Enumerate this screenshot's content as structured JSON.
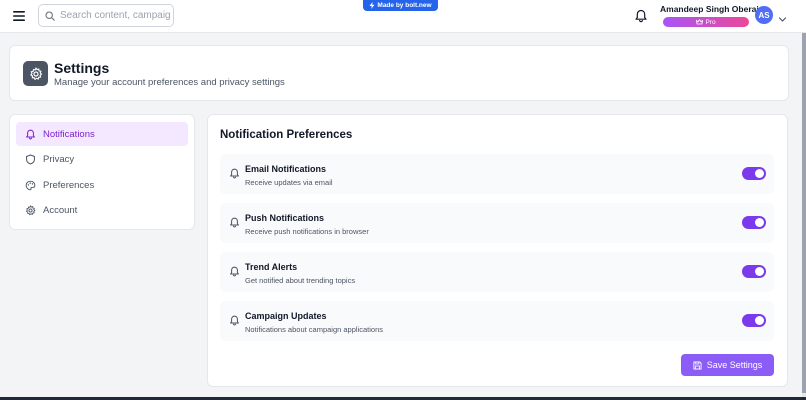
{
  "topbar": {
    "search_placeholder": "Search content, campaign",
    "bolt_badge": "Made by bolt.new",
    "user_name": "Amandeep Singh Oberai",
    "plan_badge": "Pro",
    "avatar_initials": "AS"
  },
  "header": {
    "title": "Settings",
    "subtitle": "Manage your account preferences and privacy settings"
  },
  "sidebar": {
    "items": [
      {
        "label": "Notifications",
        "icon": "bell-icon",
        "active": true
      },
      {
        "label": "Privacy",
        "icon": "shield-icon",
        "active": false
      },
      {
        "label": "Preferences",
        "icon": "palette-icon",
        "active": false
      },
      {
        "label": "Account",
        "icon": "gear-icon",
        "active": false
      }
    ]
  },
  "main": {
    "section_title": "Notification Preferences",
    "preferences": [
      {
        "title": "Email Notifications",
        "description": "Receive updates via email",
        "enabled": true
      },
      {
        "title": "Push Notifications",
        "description": "Receive push notifications in browser",
        "enabled": true
      },
      {
        "title": "Trend Alerts",
        "description": "Get notified about trending topics",
        "enabled": true
      },
      {
        "title": "Campaign Updates",
        "description": "Notifications about campaign applications",
        "enabled": true
      }
    ],
    "save_label": "Save Settings"
  },
  "colors": {
    "accent": "#7c3aed",
    "active_bg": "#f3e8ff",
    "bolt_blue": "#2563eb",
    "avatar_blue": "#4f6df5"
  }
}
